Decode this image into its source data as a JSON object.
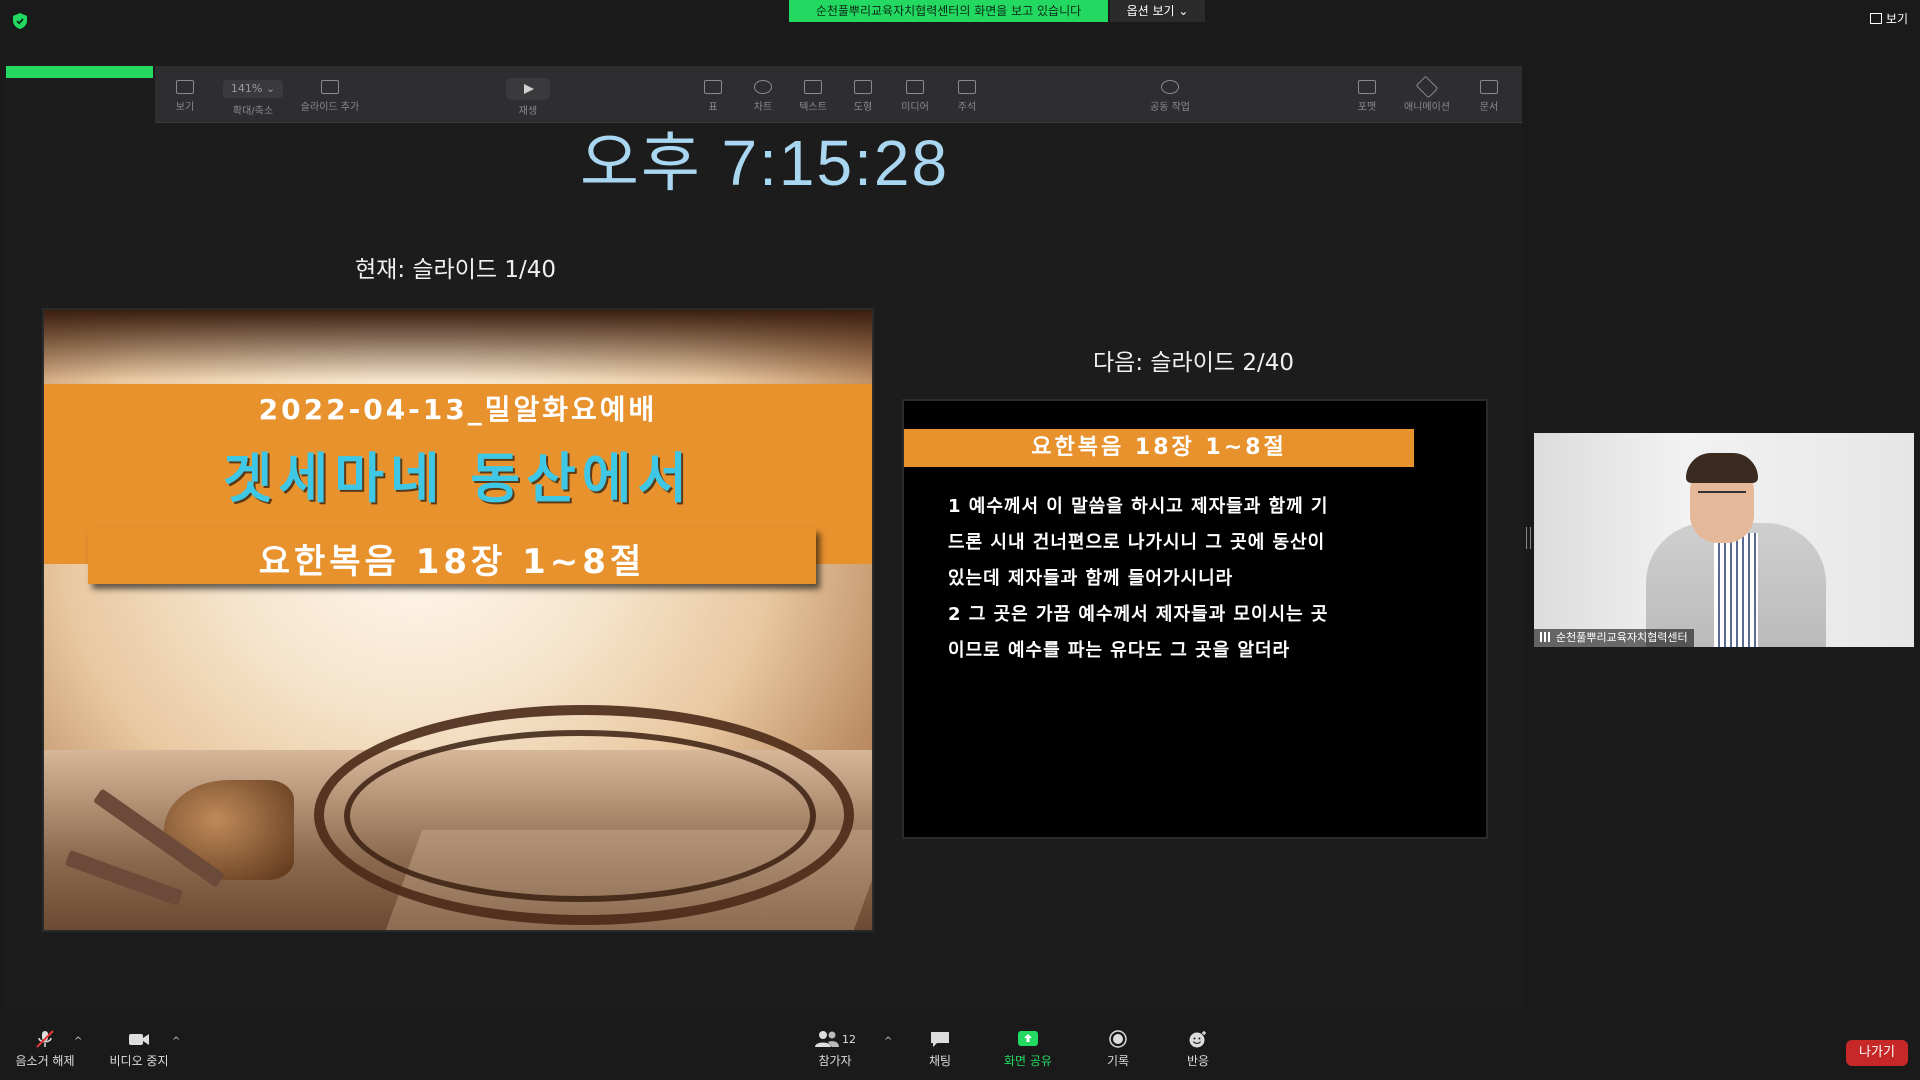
{
  "top_bar": {
    "share_banner": "순천풀뿌리교육자치협력센터의 화면을 보고 있습니다",
    "options_button": "옵션 보기 ⌄",
    "view_button": "보기"
  },
  "keynote_toolbar": {
    "items": [
      {
        "label": "보기",
        "icon": "sidebar-view-icon"
      },
      {
        "label": "확대/축소",
        "zoom_value": "141% ⌄"
      },
      {
        "label": "슬라이드 추가",
        "icon": "add-slide-icon"
      },
      {
        "label": "재생",
        "icon": "play-icon"
      },
      {
        "label": "표",
        "icon": "table-icon"
      },
      {
        "label": "차트",
        "icon": "chart-icon"
      },
      {
        "label": "텍스트",
        "icon": "text-icon"
      },
      {
        "label": "도형",
        "icon": "shape-icon"
      },
      {
        "label": "미디어",
        "icon": "media-icon"
      },
      {
        "label": "주석",
        "icon": "comment-icon"
      },
      {
        "label": "공동 작업",
        "icon": "collaborate-icon"
      },
      {
        "label": "포맷",
        "icon": "format-brush-icon"
      },
      {
        "label": "애니메이션",
        "icon": "animate-icon"
      },
      {
        "label": "문서",
        "icon": "document-icon"
      }
    ]
  },
  "presenter": {
    "clock": "오후 7:15:28",
    "current_label": "현재: 슬라이드 1/40",
    "next_label": "다음: 슬라이드 2/40"
  },
  "current_slide": {
    "date_line": "2022-04-13_밀알화요예배",
    "title": "겟세마네 동산에서",
    "subtitle": "요한복음 18장 1~8절"
  },
  "next_slide": {
    "header": "요한복음 18장 1~8절",
    "lines": [
      "1 예수께서 이 말씀을 하시고 제자들과 함께 기",
      "드론 시내 건너편으로 나가시니 그 곳에 동산이",
      "있는데 제자들과 함께 들어가시니라",
      "2 그 곳은 가끔 예수께서 제자들과 모이시는 곳",
      "이므로 예수를 파는 유다도 그 곳을 알더라"
    ]
  },
  "participant": {
    "name": "순천풀뿌리교육자치협력센터"
  },
  "controls": {
    "mute": "음소거 해제",
    "video": "비디오 중지",
    "participants": "참가자",
    "participants_count": "12",
    "chat": "채팅",
    "share": "화면 공유",
    "record": "기록",
    "reactions": "반응",
    "leave": "나가기"
  },
  "colors": {
    "share_green": "#23d962",
    "slide_orange": "#e8922e",
    "title_cyan": "#3fc8e6",
    "clock_blue": "#a9d6f0",
    "leave_red": "#c62828"
  }
}
